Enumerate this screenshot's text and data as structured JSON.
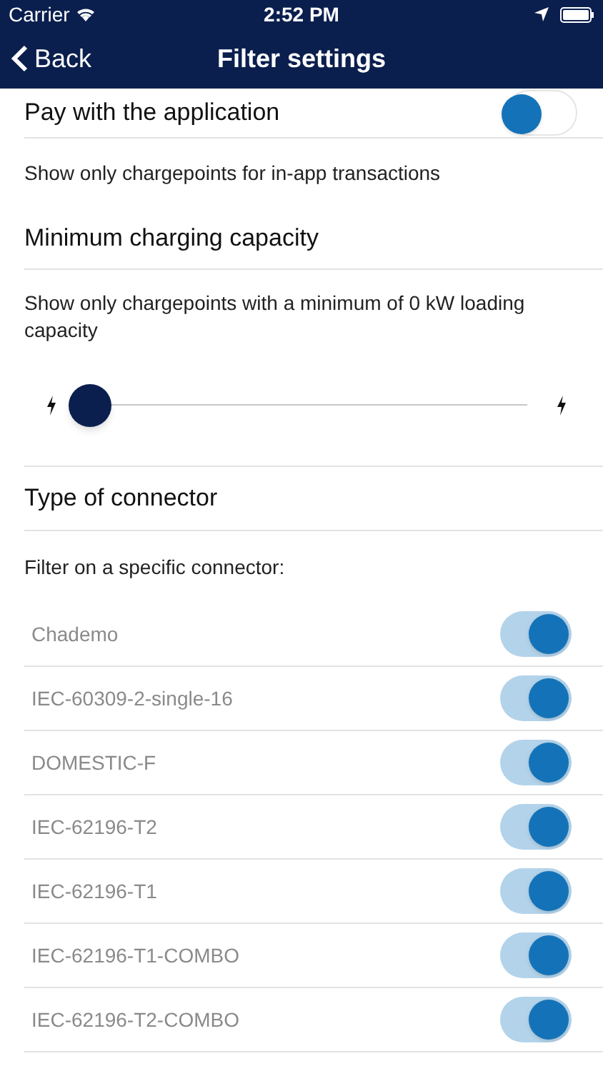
{
  "status_bar": {
    "carrier": "Carrier",
    "time": "2:52 PM"
  },
  "nav": {
    "back": "Back",
    "title": "Filter settings"
  },
  "payment": {
    "label": "Pay with the application",
    "on": false,
    "description": "Show only chargepoints for in-app transactions"
  },
  "capacity": {
    "title": "Minimum charging capacity",
    "description": "Show only chargepoints with a minimum of 0 kW loading capacity",
    "level": 0
  },
  "connector": {
    "title": "Type of connector",
    "description": "Filter on a specific connector:"
  },
  "connectors": [
    {
      "label": "Chademo",
      "on": true
    },
    {
      "label": "IEC-60309-2-single-16",
      "on": true
    },
    {
      "label": "DOMESTIC-F",
      "on": true
    },
    {
      "label": "IEC-62196-T2",
      "on": true
    },
    {
      "label": "IEC-62196-T1",
      "on": true
    },
    {
      "label": "IEC-62196-T1-COMBO",
      "on": true
    },
    {
      "label": "IEC-62196-T2-COMBO",
      "on": true
    }
  ]
}
